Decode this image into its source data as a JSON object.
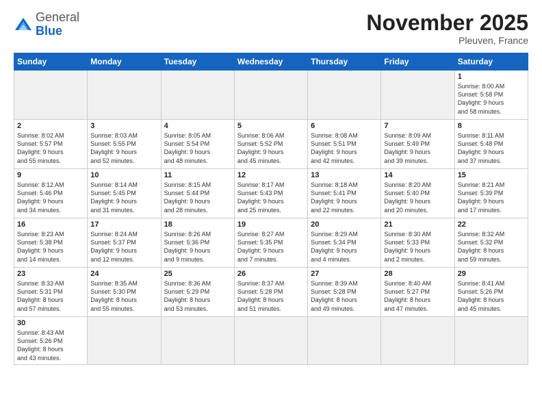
{
  "header": {
    "logo_general": "General",
    "logo_blue": "Blue",
    "month_year": "November 2025",
    "location": "Pleuven, France"
  },
  "weekdays": [
    "Sunday",
    "Monday",
    "Tuesday",
    "Wednesday",
    "Thursday",
    "Friday",
    "Saturday"
  ],
  "weeks": [
    [
      {
        "day": "",
        "info": ""
      },
      {
        "day": "",
        "info": ""
      },
      {
        "day": "",
        "info": ""
      },
      {
        "day": "",
        "info": ""
      },
      {
        "day": "",
        "info": ""
      },
      {
        "day": "",
        "info": ""
      },
      {
        "day": "1",
        "info": "Sunrise: 8:00 AM\nSunset: 5:58 PM\nDaylight: 9 hours\nand 58 minutes."
      }
    ],
    [
      {
        "day": "2",
        "info": "Sunrise: 8:02 AM\nSunset: 5:57 PM\nDaylight: 9 hours\nand 55 minutes."
      },
      {
        "day": "3",
        "info": "Sunrise: 8:03 AM\nSunset: 5:55 PM\nDaylight: 9 hours\nand 52 minutes."
      },
      {
        "day": "4",
        "info": "Sunrise: 8:05 AM\nSunset: 5:54 PM\nDaylight: 9 hours\nand 48 minutes."
      },
      {
        "day": "5",
        "info": "Sunrise: 8:06 AM\nSunset: 5:52 PM\nDaylight: 9 hours\nand 45 minutes."
      },
      {
        "day": "6",
        "info": "Sunrise: 8:08 AM\nSunset: 5:51 PM\nDaylight: 9 hours\nand 42 minutes."
      },
      {
        "day": "7",
        "info": "Sunrise: 8:09 AM\nSunset: 5:49 PM\nDaylight: 9 hours\nand 39 minutes."
      },
      {
        "day": "8",
        "info": "Sunrise: 8:11 AM\nSunset: 5:48 PM\nDaylight: 9 hours\nand 37 minutes."
      }
    ],
    [
      {
        "day": "9",
        "info": "Sunrise: 8:12 AM\nSunset: 5:46 PM\nDaylight: 9 hours\nand 34 minutes."
      },
      {
        "day": "10",
        "info": "Sunrise: 8:14 AM\nSunset: 5:45 PM\nDaylight: 9 hours\nand 31 minutes."
      },
      {
        "day": "11",
        "info": "Sunrise: 8:15 AM\nSunset: 5:44 PM\nDaylight: 9 hours\nand 28 minutes."
      },
      {
        "day": "12",
        "info": "Sunrise: 8:17 AM\nSunset: 5:43 PM\nDaylight: 9 hours\nand 25 minutes."
      },
      {
        "day": "13",
        "info": "Sunrise: 8:18 AM\nSunset: 5:41 PM\nDaylight: 9 hours\nand 22 minutes."
      },
      {
        "day": "14",
        "info": "Sunrise: 8:20 AM\nSunset: 5:40 PM\nDaylight: 9 hours\nand 20 minutes."
      },
      {
        "day": "15",
        "info": "Sunrise: 8:21 AM\nSunset: 5:39 PM\nDaylight: 9 hours\nand 17 minutes."
      }
    ],
    [
      {
        "day": "16",
        "info": "Sunrise: 8:23 AM\nSunset: 5:38 PM\nDaylight: 9 hours\nand 14 minutes."
      },
      {
        "day": "17",
        "info": "Sunrise: 8:24 AM\nSunset: 5:37 PM\nDaylight: 9 hours\nand 12 minutes."
      },
      {
        "day": "18",
        "info": "Sunrise: 8:26 AM\nSunset: 5:36 PM\nDaylight: 9 hours\nand 9 minutes."
      },
      {
        "day": "19",
        "info": "Sunrise: 8:27 AM\nSunset: 5:35 PM\nDaylight: 9 hours\nand 7 minutes."
      },
      {
        "day": "20",
        "info": "Sunrise: 8:29 AM\nSunset: 5:34 PM\nDaylight: 9 hours\nand 4 minutes."
      },
      {
        "day": "21",
        "info": "Sunrise: 8:30 AM\nSunset: 5:33 PM\nDaylight: 9 hours\nand 2 minutes."
      },
      {
        "day": "22",
        "info": "Sunrise: 8:32 AM\nSunset: 5:32 PM\nDaylight: 8 hours\nand 59 minutes."
      }
    ],
    [
      {
        "day": "23",
        "info": "Sunrise: 8:33 AM\nSunset: 5:31 PM\nDaylight: 8 hours\nand 57 minutes."
      },
      {
        "day": "24",
        "info": "Sunrise: 8:35 AM\nSunset: 5:30 PM\nDaylight: 8 hours\nand 55 minutes."
      },
      {
        "day": "25",
        "info": "Sunrise: 8:36 AM\nSunset: 5:29 PM\nDaylight: 8 hours\nand 53 minutes."
      },
      {
        "day": "26",
        "info": "Sunrise: 8:37 AM\nSunset: 5:28 PM\nDaylight: 8 hours\nand 51 minutes."
      },
      {
        "day": "27",
        "info": "Sunrise: 8:39 AM\nSunset: 5:28 PM\nDaylight: 8 hours\nand 49 minutes."
      },
      {
        "day": "28",
        "info": "Sunrise: 8:40 AM\nSunset: 5:27 PM\nDaylight: 8 hours\nand 47 minutes."
      },
      {
        "day": "29",
        "info": "Sunrise: 8:41 AM\nSunset: 5:26 PM\nDaylight: 8 hours\nand 45 minutes."
      }
    ],
    [
      {
        "day": "30",
        "info": "Sunrise: 8:43 AM\nSunset: 5:26 PM\nDaylight: 8 hours\nand 43 minutes."
      },
      {
        "day": "",
        "info": ""
      },
      {
        "day": "",
        "info": ""
      },
      {
        "day": "",
        "info": ""
      },
      {
        "day": "",
        "info": ""
      },
      {
        "day": "",
        "info": ""
      },
      {
        "day": "",
        "info": ""
      }
    ]
  ]
}
